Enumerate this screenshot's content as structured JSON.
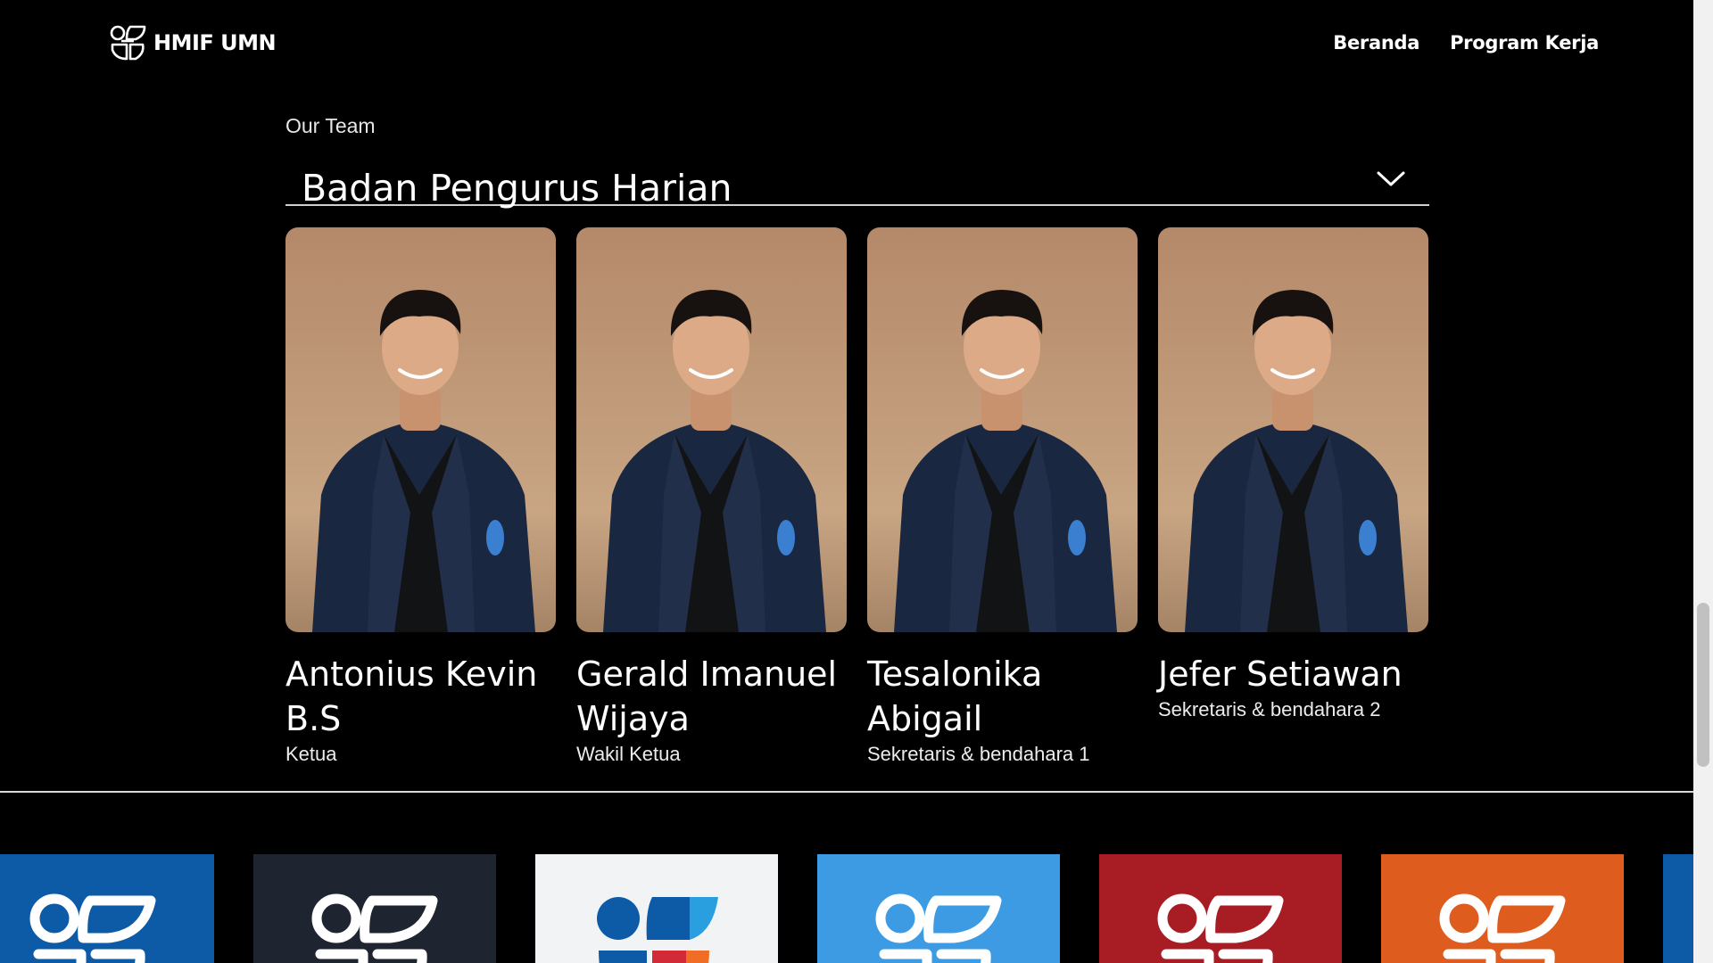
{
  "header": {
    "logo_text": "HMIF UMN",
    "nav": [
      {
        "label": "Beranda"
      },
      {
        "label": "Program Kerja"
      }
    ]
  },
  "team": {
    "eyebrow": "Our Team",
    "selected_division": "Badan Pengurus Harian",
    "members": [
      {
        "name": "Antonius Kevin B.S",
        "role": "Ketua"
      },
      {
        "name": "Gerald Imanuel Wijaya",
        "role": "Wakil Ketua"
      },
      {
        "name": "Tesalonika Abigail",
        "role": "Sekretaris & bendahara 1"
      },
      {
        "name": "Jefer Setiawan",
        "role": "Sekretaris & bendahara 2"
      }
    ]
  },
  "logo_strip": {
    "tiles": [
      {
        "bg": "#0d5aa7",
        "icon": "hmif-logo-icon"
      },
      {
        "bg": "#1f2530",
        "icon": "hmif-logo-icon"
      },
      {
        "bg": "#f2f3f5",
        "icon": "hmif-color-logo-icon"
      },
      {
        "bg": "#3d9be4",
        "icon": "hmif-logo-icon"
      },
      {
        "bg": "#a81c24",
        "icon": "hmif-logo-icon"
      },
      {
        "bg": "#dd5c1e",
        "icon": "hmif-logo-icon"
      },
      {
        "bg": "#0d5aa7",
        "icon": "hmif-logo-icon"
      }
    ]
  },
  "colors": {
    "background": "#000000",
    "text": "#ffffff",
    "photo_wall": "#c9a27e",
    "jacket": "#1a2740"
  }
}
